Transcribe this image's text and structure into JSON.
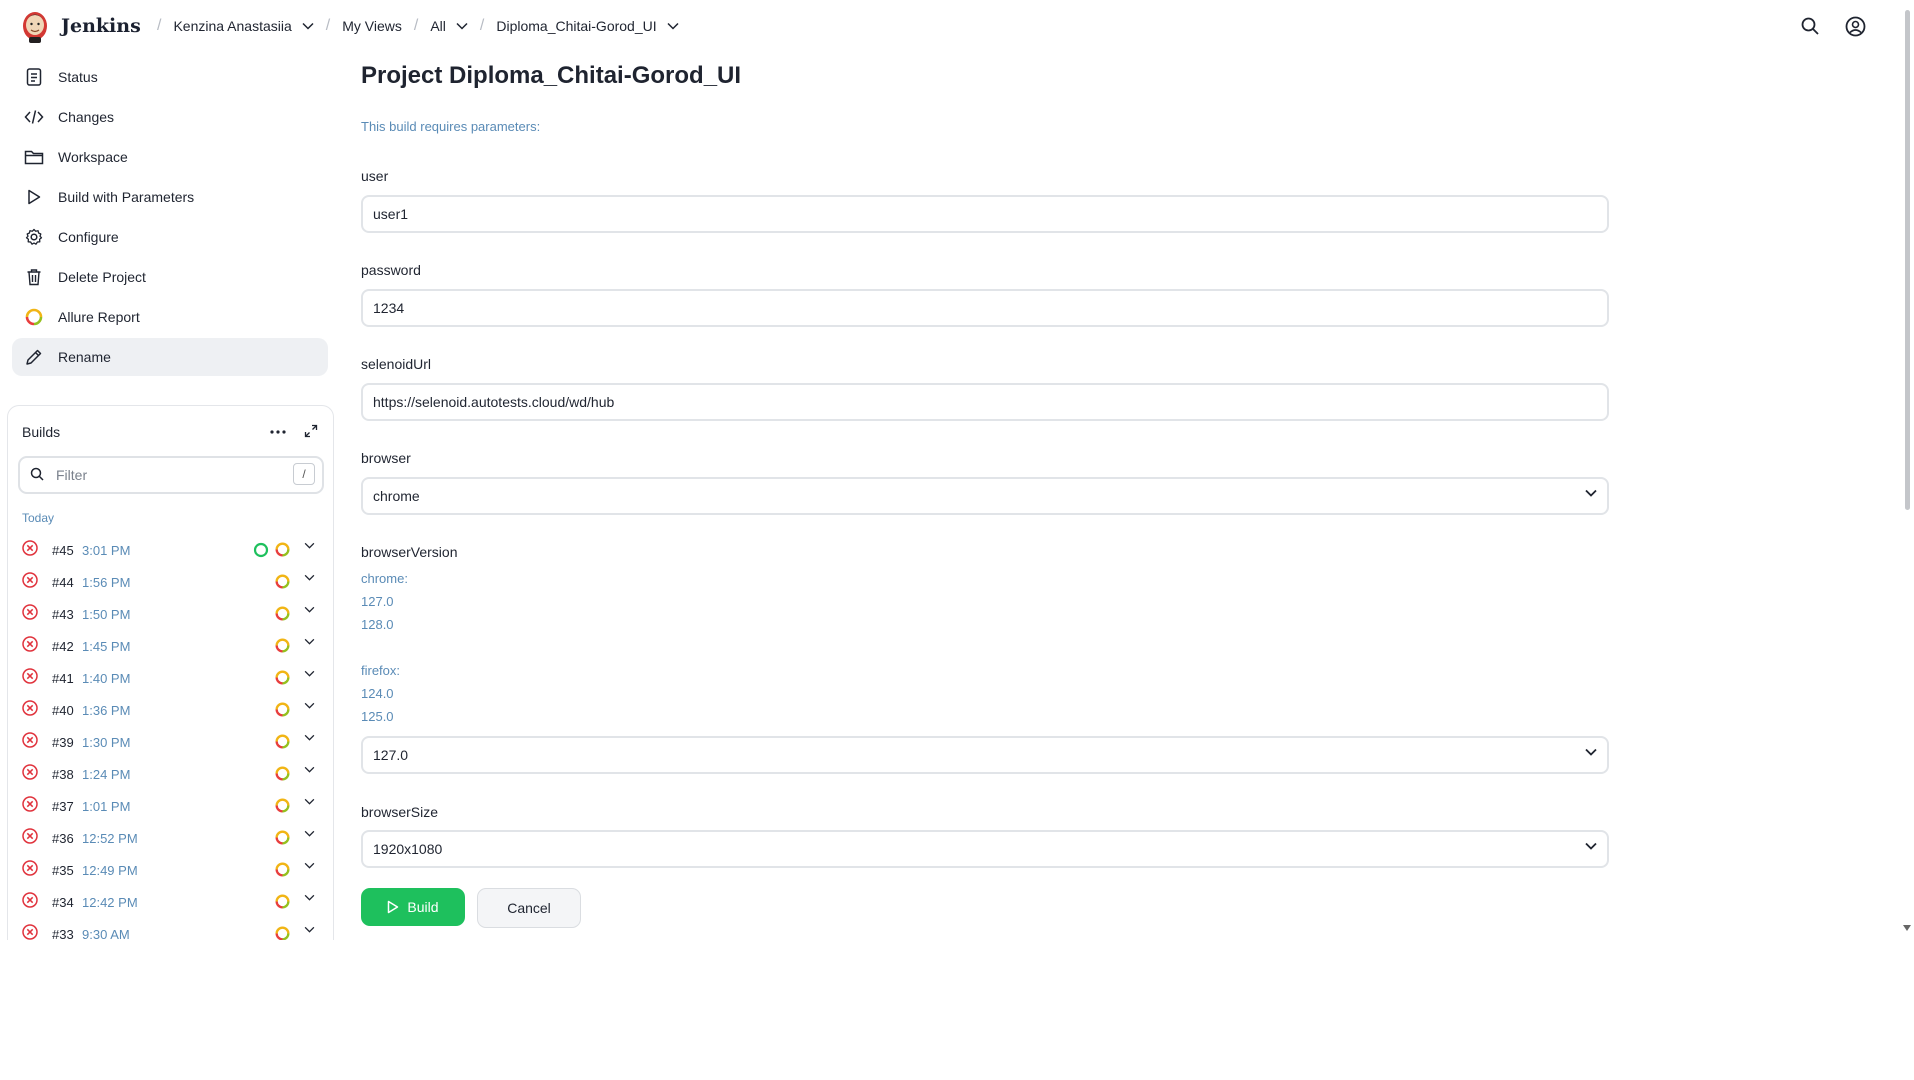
{
  "header": {
    "brand": "Jenkins",
    "breadcrumbs": [
      {
        "label": "Kenzina Anastasiia",
        "dropdown": true
      },
      {
        "label": "My Views",
        "dropdown": false
      },
      {
        "label": "All",
        "dropdown": true
      },
      {
        "label": "Diploma_Chitai-Gorod_UI",
        "dropdown": true
      }
    ],
    "icons": [
      "search-icon",
      "user-account-icon"
    ]
  },
  "sidebar": {
    "tasks": [
      {
        "label": "Status",
        "icon": "notepad-icon"
      },
      {
        "label": "Changes",
        "icon": "code-icon"
      },
      {
        "label": "Workspace",
        "icon": "folder-icon"
      },
      {
        "label": "Build with Parameters",
        "icon": "play-icon"
      },
      {
        "label": "Configure",
        "icon": "gear-icon"
      },
      {
        "label": "Delete Project",
        "icon": "trash-icon"
      },
      {
        "label": "Allure Report",
        "icon": "allure-icon"
      },
      {
        "label": "Rename",
        "icon": "pencil-icon",
        "active": true
      }
    ]
  },
  "builds": {
    "title": "Builds",
    "filter_placeholder": "Filter",
    "filter_shortcut": "/",
    "group_label": "Today",
    "items": [
      {
        "number": "#45",
        "time": "3:01 PM",
        "running": true
      },
      {
        "number": "#44",
        "time": "1:56 PM"
      },
      {
        "number": "#43",
        "time": "1:50 PM"
      },
      {
        "number": "#42",
        "time": "1:45 PM"
      },
      {
        "number": "#41",
        "time": "1:40 PM"
      },
      {
        "number": "#40",
        "time": "1:36 PM"
      },
      {
        "number": "#39",
        "time": "1:30 PM"
      },
      {
        "number": "#38",
        "time": "1:24 PM"
      },
      {
        "number": "#37",
        "time": "1:01 PM"
      },
      {
        "number": "#36",
        "time": "12:52 PM"
      },
      {
        "number": "#35",
        "time": "12:49 PM"
      },
      {
        "number": "#34",
        "time": "12:42 PM"
      },
      {
        "number": "#33",
        "time": "9:30 AM"
      }
    ]
  },
  "main": {
    "title": "Project Diploma_Chitai-Gorod_UI",
    "requires_text": "This build requires parameters:",
    "params": {
      "user": {
        "label": "user",
        "value": "user1"
      },
      "password": {
        "label": "password",
        "value": "1234"
      },
      "selenoidUrl": {
        "label": "selenoidUrl",
        "value": "https://selenoid.autotests.cloud/wd/hub"
      },
      "browser": {
        "label": "browser",
        "value": "chrome"
      },
      "browserVersion": {
        "label": "browserVersion",
        "description": [
          "chrome:",
          "127.0",
          "128.0",
          "",
          "firefox:",
          "124.0",
          "125.0"
        ],
        "value": "127.0"
      },
      "browserSize": {
        "label": "browserSize",
        "value": "1920x1080"
      }
    },
    "build_label": "Build",
    "cancel_label": "Cancel"
  },
  "colors": {
    "accent_green": "#1ec05d",
    "link_blue": "#5a8bb6",
    "failure_red": "#e0323c"
  }
}
